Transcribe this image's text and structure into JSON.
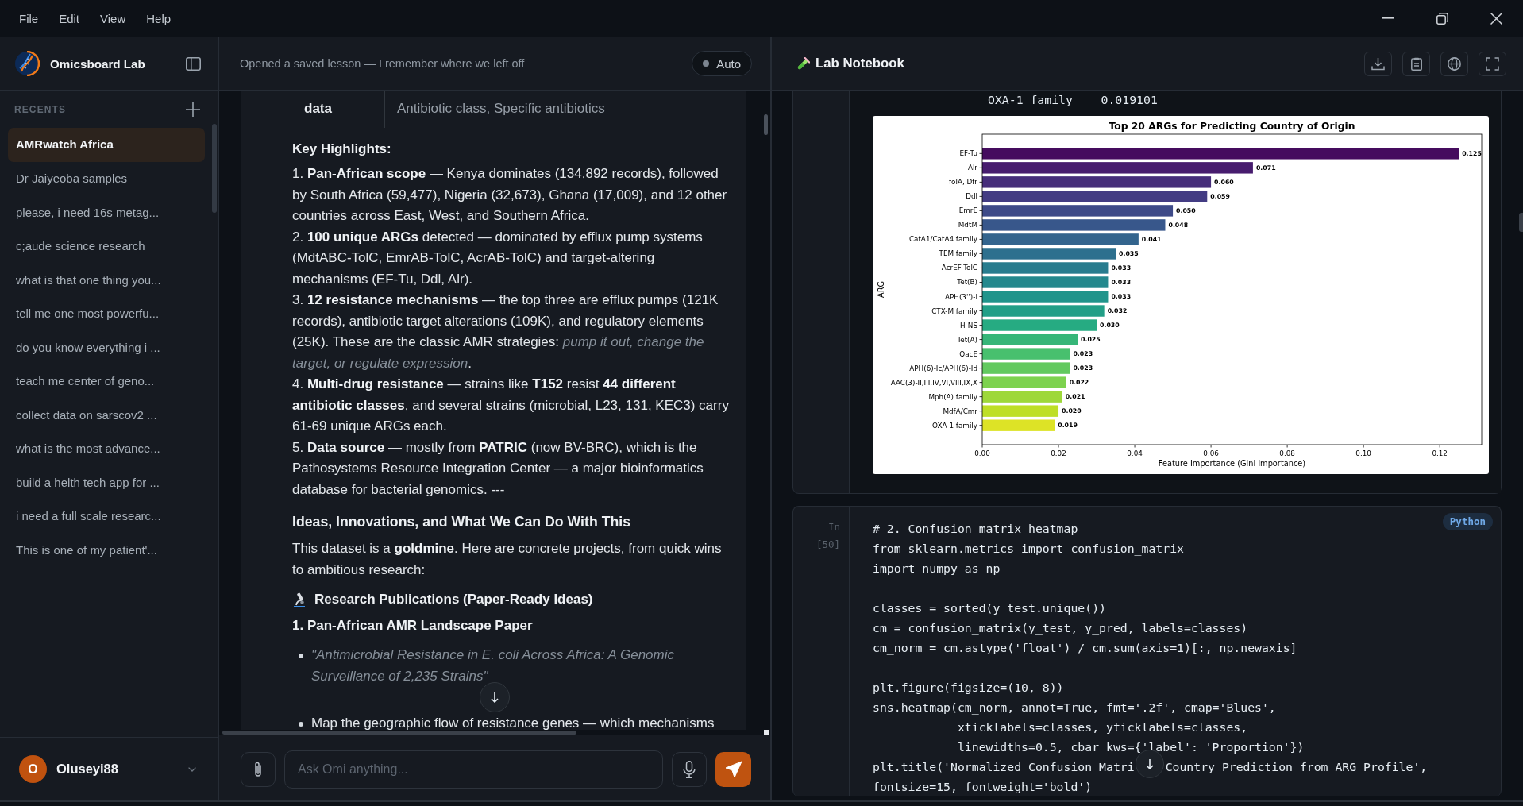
{
  "menu_bar": {
    "items": [
      "File",
      "Edit",
      "View",
      "Help"
    ]
  },
  "sidebar": {
    "app_name": "Omicsboard Lab",
    "recents_label": "RECENTS",
    "items": [
      {
        "label": "AMRwatch Africa",
        "selected": true
      },
      {
        "label": "Dr Jaiyeoba samples",
        "selected": false
      },
      {
        "label": "please, i need 16s metag...",
        "selected": false
      },
      {
        "label": "c;aude science research",
        "selected": false
      },
      {
        "label": "what is that one thing you...",
        "selected": false
      },
      {
        "label": "tell me one most powerfu...",
        "selected": false
      },
      {
        "label": "do you know everything i ...",
        "selected": false
      },
      {
        "label": "teach me center of geno...",
        "selected": false
      },
      {
        "label": "collect data on sarscov2 ...",
        "selected": false
      },
      {
        "label": "what is the most advance...",
        "selected": false
      },
      {
        "label": "build a helth tech app for ...",
        "selected": false
      },
      {
        "label": "i need a full scale researc...",
        "selected": false
      },
      {
        "label": "This is one of my patient'...",
        "selected": false
      }
    ],
    "user": {
      "initial": "O",
      "name": "Oluseyi88"
    }
  },
  "chat": {
    "banner": "Opened a saved lesson — I remember where we left off",
    "mode": {
      "label": "Auto"
    },
    "table_row": {
      "label": "data",
      "value": "Antibiotic class, Specific antibiotics"
    },
    "blocks": [
      {
        "kind": "label",
        "text": "Key Highlights:"
      },
      {
        "kind": "item",
        "text": "1. **Pan-African scope** — Kenya dominates (134,892 records), followed by South Africa (59,477), Nigeria (32,673), Ghana (17,009), and 12 other countries across East, West, and Southern Africa."
      },
      {
        "kind": "item",
        "text": "2. **100 unique ARGs** detected — dominated by efflux pump systems (MdtABC-TolC, EmrAB-TolC, AcrAB-TolC) and target-altering mechanisms (EF-Tu, Ddl, Alr)."
      },
      {
        "kind": "item",
        "text": "3. **12 resistance mechanisms** — the top three are efflux pumps (121K records), antibiotic target alterations (109K), and regulatory elements (25K). These are the classic AMR strategies: *pump it out, change the target, or regulate expression*."
      },
      {
        "kind": "item",
        "text": "4. **Multi-drug resistance** — strains like **T152** resist **44 different antibiotic classes**, and several strains (microbial, L23, 131, KEC3) carry 61-69 unique ARGs each."
      },
      {
        "kind": "item",
        "text": "5. **Data source** — mostly from **PATRIC** (now BV-BRC), which is the Pathosystems Resource Integration Center — a major bioinformatics database for bacterial genomics. ---"
      },
      {
        "kind": "heading",
        "text": "Ideas, Innovations, and What We Can Do With This"
      },
      {
        "kind": "paragraph",
        "text": "This dataset is a **goldmine**. Here are concrete projects, from quick wins to ambitious research:"
      },
      {
        "kind": "section",
        "text": "Research Publications (Paper-Ready Ideas)"
      },
      {
        "kind": "label",
        "text": "1. Pan-African AMR Landscape Paper"
      },
      {
        "kind": "quote",
        "text": "\"Antimicrobial Resistance in E. coli Across Africa: A Genomic Surveillance of 2,235 Strains\""
      },
      {
        "kind": "bullet",
        "text": "Map the geographic flow of resistance genes — which mechanisms"
      }
    ],
    "input": {
      "placeholder": "Ask Omi anything..."
    }
  },
  "notebook": {
    "title": "Lab Notebook",
    "output_text": "OXA-1 family    0.019101",
    "chart_data": {
      "type": "bar",
      "orientation": "horizontal",
      "title": "Top 20 ARGs for Predicting Country of Origin",
      "xlabel": "Feature Importance (Gini importance)",
      "ylabel": "ARG",
      "categories": [
        "EF-Tu",
        "Alr",
        "folA, Dfr",
        "Ddl",
        "EmrE",
        "MdtM",
        "CatA1/CatA4 family",
        "TEM family",
        "AcrEF-TolC",
        "Tet(B)",
        "APH(3'')-I",
        "CTX-M family",
        "H-NS",
        "Tet(A)",
        "QacE",
        "APH(6)-Ic/APH(6)-Id",
        "AAC(3)-II,III,IV,VI,VIII,IX,X",
        "Mph(A) family",
        "MdfA/Cmr",
        "OXA-1 family"
      ],
      "values": [
        0.125,
        0.071,
        0.06,
        0.059,
        0.05,
        0.048,
        0.041,
        0.035,
        0.033,
        0.033,
        0.033,
        0.032,
        0.03,
        0.025,
        0.023,
        0.023,
        0.022,
        0.021,
        0.02,
        0.019
      ],
      "xlim": [
        0,
        0.131
      ],
      "xticks": [
        {
          "value": 0,
          "label": "0.00"
        },
        {
          "value": 0.02,
          "label": "0.02"
        },
        {
          "value": 0.04,
          "label": "0.04"
        },
        {
          "value": 0.06,
          "label": "0.06"
        },
        {
          "value": 0.08,
          "label": "0.08"
        },
        {
          "value": 0.1,
          "label": "0.10"
        },
        {
          "value": 0.12,
          "label": "0.12"
        }
      ],
      "value_labels": [
        "0.125",
        "0.071",
        "0.060",
        "0.059",
        "0.050",
        "0.048",
        "0.041",
        "0.035",
        "0.033",
        "0.033",
        "0.033",
        "0.032",
        "0.030",
        "0.025",
        "0.023",
        "0.023",
        "0.022",
        "0.021",
        "0.020",
        "0.019"
      ]
    },
    "code_cell": {
      "prompt": "In",
      "count": "[50]",
      "language": "Python",
      "lines": [
        {
          "kind": "code",
          "parts": [
            "# 2. Confusion matrix heatmap"
          ]
        },
        {
          "kind": "code",
          "parts": [
            "from sklearn.metrics import confusion_matrix"
          ]
        },
        {
          "kind": "code",
          "parts": [
            "import numpy as np"
          ]
        },
        {
          "kind": "blank"
        },
        {
          "kind": "code",
          "parts": [
            "classes = sorted(y_test.unique())"
          ]
        },
        {
          "kind": "code",
          "parts": [
            "cm = confusion_matrix(y_test, y_pred, labels=classes)"
          ]
        },
        {
          "kind": "code",
          "parts": [
            "cm_norm = cm.astype('float') / cm.sum(axis=1)[:, np.newaxis]"
          ]
        },
        {
          "kind": "blank"
        },
        {
          "kind": "code",
          "parts": [
            "plt.figure(figsize=(10, 8))"
          ]
        },
        {
          "kind": "code",
          "parts": [
            "sns.heatmap(cm_norm, annot=True, fmt='.2f', cmap='Blues',"
          ]
        },
        {
          "kind": "code",
          "parts": [
            "            xticklabels=classes, yticklabels=classes,"
          ]
        },
        {
          "kind": "code",
          "parts": [
            "            linewidths=0.5, cbar_kws={'label': 'Proportion'})"
          ]
        },
        {
          "kind": "code",
          "parts": [
            "plt.title('Normalized Confusion Matri",
            "Country Prediction from ARG Profile',"
          ]
        },
        {
          "kind": "code",
          "parts": [
            "fontsize=15, fontweight='bold')"
          ]
        }
      ]
    }
  }
}
